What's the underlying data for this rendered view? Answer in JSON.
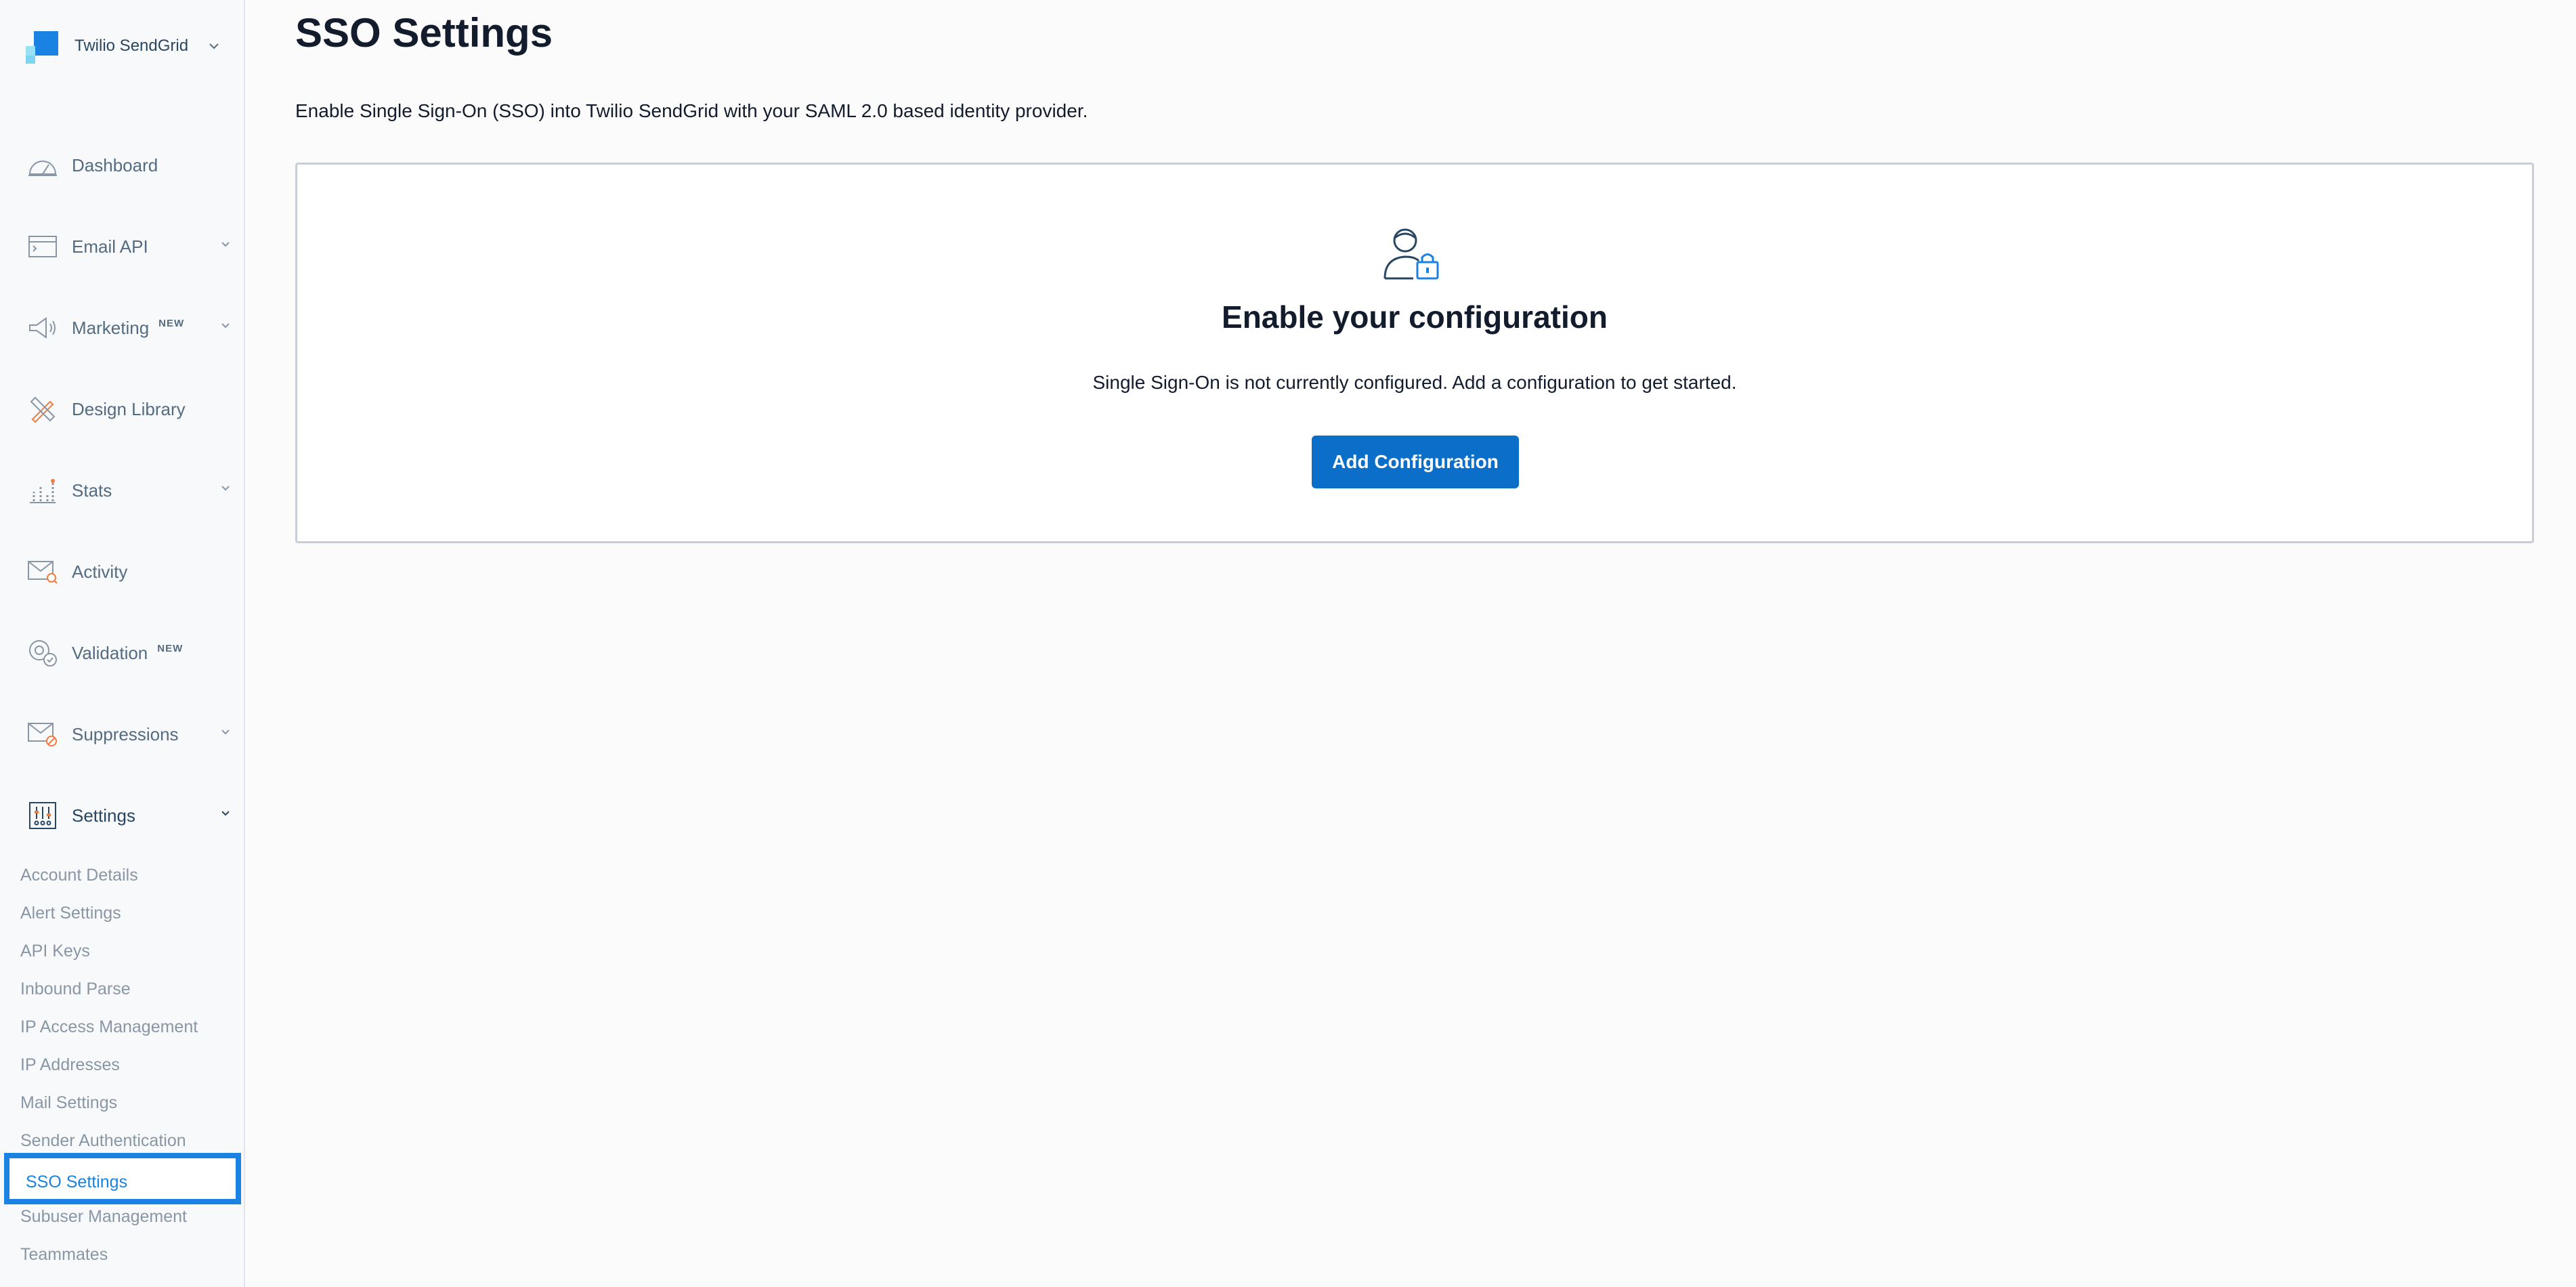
{
  "brand": {
    "name": "Twilio SendGrid"
  },
  "nav": {
    "dashboard": "Dashboard",
    "email_api": "Email API",
    "marketing": "Marketing",
    "marketing_badge": "NEW",
    "design_library": "Design Library",
    "stats": "Stats",
    "activity": "Activity",
    "validation": "Validation",
    "validation_badge": "NEW",
    "suppressions": "Suppressions",
    "settings": "Settings"
  },
  "settings_menu": [
    "Account Details",
    "Alert Settings",
    "API Keys",
    "Inbound Parse",
    "IP Access Management",
    "IP Addresses",
    "Mail Settings",
    "Sender Authentication",
    "SSO Settings",
    "Subuser Management",
    "Teammates"
  ],
  "page": {
    "title": "SSO Settings",
    "description": "Enable Single Sign-On (SSO) into Twilio SendGrid with your SAML 2.0 based identity provider."
  },
  "card": {
    "title": "Enable your configuration",
    "text": "Single Sign-On is not currently configured. Add a configuration to get started.",
    "button_label": "Add Configuration"
  },
  "colors": {
    "accent": "#1a82e2",
    "button": "#0b6fc9",
    "nav_icon_accent": "#f57a3d"
  }
}
